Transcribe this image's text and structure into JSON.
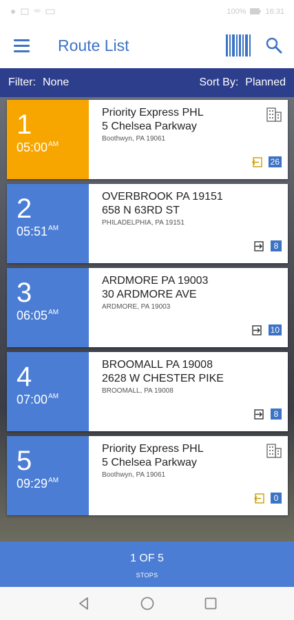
{
  "status_bar": {
    "left_icons": [
      "notification-icon",
      "image-icon",
      "wifi-icon",
      "keyboard-icon"
    ],
    "battery": "100%",
    "time": "16:31"
  },
  "app_bar": {
    "title": "Route List",
    "accent": "#3d73c4"
  },
  "filter_bar": {
    "filter_label": "Filter:",
    "filter_value": "None",
    "sort_label": "Sort By:",
    "sort_value": "Planned",
    "bg": "#2d3e8c"
  },
  "stops": [
    {
      "number": "1",
      "time": "05:00",
      "ampm": "AM",
      "line1": "Priority Express PHL",
      "line2": "5 Chelsea Parkway",
      "line3": "Boothwyn, PA 19061",
      "count": "26",
      "direction": "pickup",
      "building_icon": true,
      "color": "#f7a600"
    },
    {
      "number": "2",
      "time": "05:51",
      "ampm": "AM",
      "line1": "OVERBROOK PA 19151",
      "line2": "658 N 63RD ST",
      "line3": "PHILADELPHIA, PA 19151",
      "count": "8",
      "direction": "delivery",
      "building_icon": false,
      "color": "#4a7dd3"
    },
    {
      "number": "3",
      "time": "06:05",
      "ampm": "AM",
      "line1": "ARDMORE PA 19003",
      "line2": "30 ARDMORE AVE",
      "line3": "ARDMORE, PA 19003",
      "count": "10",
      "direction": "delivery",
      "building_icon": false,
      "color": "#4a7dd3"
    },
    {
      "number": "4",
      "time": "07:00",
      "ampm": "AM",
      "line1": "BROOMALL PA 19008",
      "line2": "2628 W CHESTER PIKE",
      "line3": "BROOMALL, PA 19008",
      "count": "8",
      "direction": "delivery",
      "building_icon": false,
      "color": "#4a7dd3"
    },
    {
      "number": "5",
      "time": "09:29",
      "ampm": "AM",
      "line1": "Priority Express PHL",
      "line2": "5 Chelsea Parkway",
      "line3": "Boothwyn, PA 19061",
      "count": "0",
      "direction": "pickup",
      "building_icon": true,
      "color": "#4a7dd3"
    }
  ],
  "footer": {
    "page": "1 OF 5",
    "unit": "STOPS"
  },
  "nav": {
    "buttons": [
      "back-icon",
      "home-icon",
      "recents-icon"
    ]
  }
}
